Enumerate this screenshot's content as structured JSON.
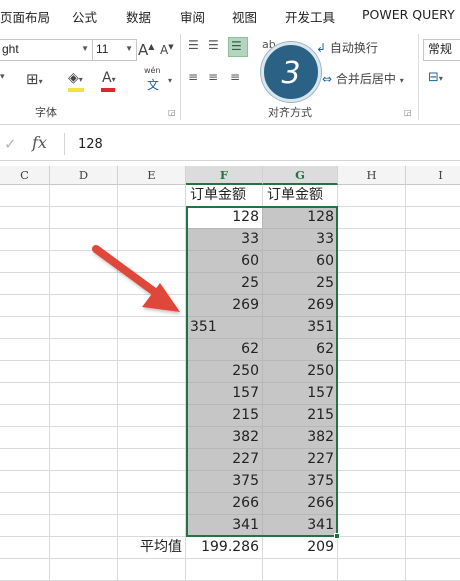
{
  "ribbon_tabs": [
    "页面布局",
    "公式",
    "数据",
    "审阅",
    "视图",
    "开发工具",
    "POWER QUERY"
  ],
  "ribbon": {
    "font_name_value": "ght",
    "font_size_value": "11",
    "grow_font_label": "A",
    "shrink_font_label": "A",
    "font_color_label": "A",
    "phonetic_top": "wén",
    "phonetic_bottom": "文",
    "wrap_text_label": "自动换行",
    "merge_center_label": "合并后居中",
    "number_format_value": "常规",
    "font_group_label": "字体",
    "alignment_group_label": "对齐方式"
  },
  "step_badge": "3",
  "formula_bar": {
    "fx_label": "fx",
    "cancel_glyph": "✓",
    "content": "128"
  },
  "columns": [
    "C",
    "D",
    "E",
    "F",
    "G",
    "H",
    "I"
  ],
  "headers": {
    "F": "订单金额",
    "G": "订单金额"
  },
  "rows": [
    {
      "f": "128",
      "g": "128"
    },
    {
      "f": "33",
      "g": "33"
    },
    {
      "f": "60",
      "g": "60"
    },
    {
      "f": "25",
      "g": "25"
    },
    {
      "f": "269",
      "g": "269"
    },
    {
      "f": "351",
      "g": "351",
      "f_text": true
    },
    {
      "f": "62",
      "g": "62"
    },
    {
      "f": "250",
      "g": "250"
    },
    {
      "f": "157",
      "g": "157"
    },
    {
      "f": "215",
      "g": "215"
    },
    {
      "f": "382",
      "g": "382"
    },
    {
      "f": "227",
      "g": "227"
    },
    {
      "f": "375",
      "g": "375"
    },
    {
      "f": "266",
      "g": "266"
    },
    {
      "f": "341",
      "g": "341"
    }
  ],
  "summary": {
    "label": "平均值",
    "f": "199.286",
    "g": "209"
  },
  "colors": {
    "accent": "#217346",
    "selection_fill": "#c6c6c6",
    "arrow": "#e0463a",
    "badge": "#2a6184"
  }
}
